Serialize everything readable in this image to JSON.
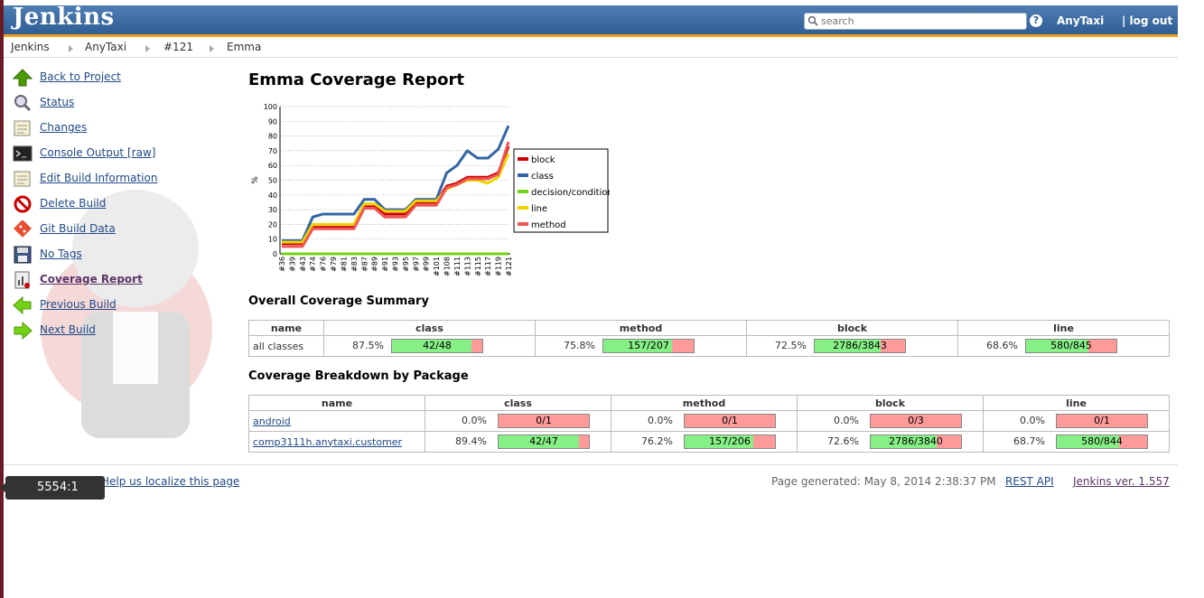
{
  "header": {
    "logo": "Jenkins",
    "search_placeholder": "search",
    "help_label": "?",
    "user": "AnyTaxi",
    "logout": "| log out"
  },
  "breadcrumbs": [
    "Jenkins",
    "AnyTaxi",
    "#121",
    "Emma"
  ],
  "sidebar": {
    "items": [
      {
        "label": "Back to Project",
        "icon": "up-arrow-icon"
      },
      {
        "label": "Status",
        "icon": "magnifier-icon"
      },
      {
        "label": "Changes",
        "icon": "notepad-icon"
      },
      {
        "label": "Console Output",
        "extra": "[raw]",
        "icon": "terminal-icon"
      },
      {
        "label": "Edit Build Information",
        "icon": "notepad-icon"
      },
      {
        "label": "Delete Build",
        "icon": "no-entry-icon"
      },
      {
        "label": "Git Build Data",
        "icon": "git-icon"
      },
      {
        "label": "No Tags",
        "icon": "floppy-icon"
      },
      {
        "label": "Coverage Report",
        "icon": "report-icon"
      },
      {
        "label": "Previous Build",
        "icon": "left-arrow-icon"
      },
      {
        "label": "Next Build",
        "icon": "right-arrow-icon"
      }
    ]
  },
  "main": {
    "title": "Emma Coverage Report",
    "overall_title": "Overall Coverage Summary",
    "breakdown_title": "Coverage Breakdown by Package"
  },
  "chart_data": {
    "type": "line",
    "ylabel": "%",
    "ylim": [
      0,
      100
    ],
    "yticks": [
      0,
      10,
      20,
      30,
      40,
      50,
      60,
      70,
      80,
      90,
      100
    ],
    "grid": true,
    "legend": "right",
    "x_tick_labels": [
      "#36",
      "#39",
      "#43",
      "#74",
      "#76",
      "#79",
      "#81",
      "#83",
      "#87",
      "#89",
      "#91",
      "#93",
      "#95",
      "#97",
      "#99",
      "#101",
      "#108",
      "#111",
      "#113",
      "#115",
      "#117",
      "#119",
      "#121"
    ],
    "x": [
      36,
      39,
      43,
      74,
      76,
      79,
      81,
      83,
      87,
      89,
      91,
      93,
      95,
      97,
      99,
      101,
      108,
      111,
      113,
      115,
      117,
      119,
      121
    ],
    "series": [
      {
        "name": "block",
        "color": "#cc0000",
        "values": [
          7,
          7,
          7,
          18,
          18,
          18,
          18,
          18,
          32,
          32,
          27,
          27,
          27,
          35,
          35,
          35,
          46,
          48,
          52,
          52,
          52,
          55,
          73
        ]
      },
      {
        "name": "class",
        "color": "#3465a4",
        "values": [
          9,
          9,
          9,
          25,
          27,
          27,
          27,
          27,
          37,
          37,
          30,
          30,
          30,
          37,
          37,
          37,
          55,
          60,
          70,
          65,
          65,
          71,
          87
        ]
      },
      {
        "name": "decision/condition",
        "color": "#73d216",
        "values": [
          0,
          0,
          0,
          0,
          0,
          0,
          0,
          0,
          0,
          0,
          0,
          0,
          0,
          0,
          0,
          0,
          0,
          0,
          0,
          0,
          0,
          0,
          0
        ]
      },
      {
        "name": "line",
        "color": "#edd400",
        "values": [
          8,
          8,
          8,
          20,
          20,
          20,
          20,
          20,
          34,
          34,
          29,
          29,
          29,
          36,
          36,
          36,
          44,
          47,
          50,
          50,
          48,
          52,
          68
        ]
      },
      {
        "name": "method",
        "color": "#ef5555",
        "values": [
          5,
          5,
          5,
          17,
          17,
          17,
          17,
          17,
          31,
          31,
          25,
          25,
          25,
          33,
          33,
          33,
          45,
          47,
          51,
          51,
          51,
          54,
          76
        ]
      }
    ]
  },
  "overall": {
    "headers": [
      "name",
      "class",
      "method",
      "block",
      "line"
    ],
    "row": {
      "name": "all classes",
      "cells": [
        {
          "pct": "87.5%",
          "frac": "42/48",
          "ratio": 0.875
        },
        {
          "pct": "75.8%",
          "frac": "157/207",
          "ratio": 0.758
        },
        {
          "pct": "72.5%",
          "frac": "2786/3843",
          "ratio": 0.725
        },
        {
          "pct": "68.6%",
          "frac": "580/845",
          "ratio": 0.686
        }
      ]
    }
  },
  "packages": {
    "headers": [
      "name",
      "class",
      "method",
      "block",
      "line"
    ],
    "rows": [
      {
        "name": "android",
        "cells": [
          {
            "pct": "0.0%",
            "frac": "0/1",
            "ratio": 0
          },
          {
            "pct": "0.0%",
            "frac": "0/1",
            "ratio": 0
          },
          {
            "pct": "0.0%",
            "frac": "0/3",
            "ratio": 0
          },
          {
            "pct": "0.0%",
            "frac": "0/1",
            "ratio": 0
          }
        ]
      },
      {
        "name": "comp3111h.anytaxi.customer",
        "cells": [
          {
            "pct": "89.4%",
            "frac": "42/47",
            "ratio": 0.894
          },
          {
            "pct": "76.2%",
            "frac": "157/206",
            "ratio": 0.762
          },
          {
            "pct": "72.6%",
            "frac": "2786/3840",
            "ratio": 0.726
          },
          {
            "pct": "68.7%",
            "frac": "580/844",
            "ratio": 0.687
          }
        ]
      }
    ]
  },
  "footer": {
    "help_link": "Help us localize this page",
    "generated": "Page generated: May 8, 2014 2:38:37 PM",
    "rest_api": "REST API",
    "version": "Jenkins ver. 1.557"
  },
  "tooltip": "5554:1"
}
